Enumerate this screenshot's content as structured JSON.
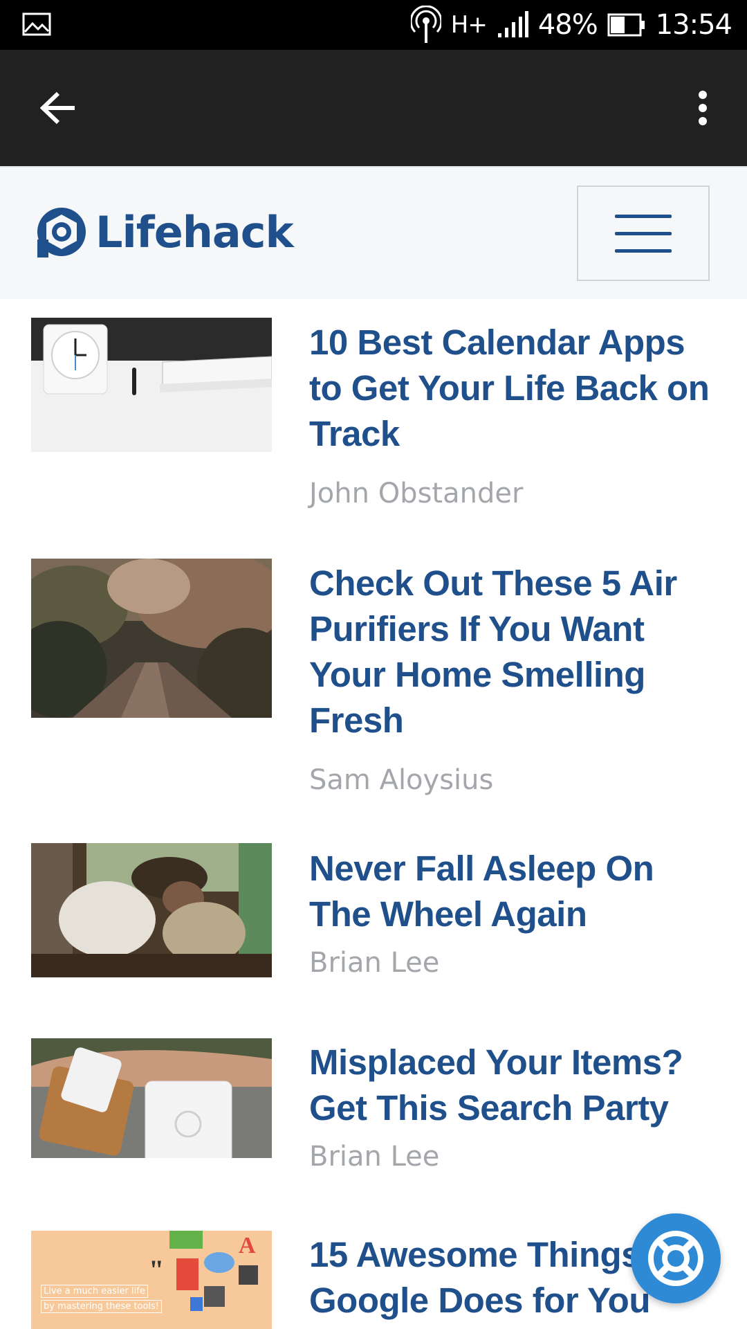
{
  "status_bar": {
    "network": "H+",
    "battery": "48%",
    "time": "13:54",
    "icons": [
      "gallery-icon",
      "hotspot-icon",
      "network-type-icon",
      "signal-icon",
      "battery-icon"
    ]
  },
  "app_bar": {
    "back_icon": "arrow-left-icon",
    "more_icon": "more-vertical-icon"
  },
  "site_header": {
    "logo_text": "Lifehack",
    "brand_color": "#20508b",
    "menu_icon": "hamburger-icon"
  },
  "articles": [
    {
      "title": "10 Best Calendar Apps to Get Your Life Back on Track",
      "author": "John Obstander",
      "image": "clock-notebook-photo"
    },
    {
      "title": "Check Out These 5 Air Purifiers If You Want Your Home Smelling Fresh",
      "author": "Sam Aloysius",
      "image": "forest-bridge-photo"
    },
    {
      "title": "Never Fall Asleep On The Wheel Again",
      "author": "Brian Lee",
      "image": "man-asleep-car-photo"
    },
    {
      "title": "Misplaced Your Items? Get This Search Party",
      "author": "Brian Lee",
      "image": "tile-tracker-photo"
    },
    {
      "title": "15 Awesome Things Google Does for You",
      "author": "",
      "image": "google-tools-illustration",
      "image_caption_1": "Live a much easier life",
      "image_caption_2": "by mastering these tools!"
    }
  ],
  "help_fab": {
    "icon": "lifebuoy-icon",
    "color": "#2f8ad6"
  }
}
